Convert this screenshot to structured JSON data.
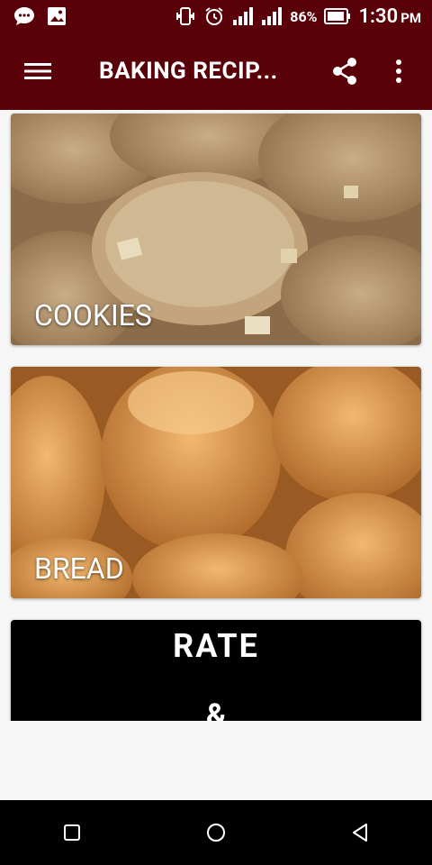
{
  "status_bar": {
    "battery": "86%",
    "time": "1:30",
    "ampm": "PM",
    "icons": [
      "chat-icon",
      "image-icon",
      "vibrate-icon",
      "alarm-icon",
      "signal-icon",
      "signal-icon",
      "battery-icon"
    ]
  },
  "app_bar": {
    "title": "BAKING RECIP...",
    "color": "#5a0009",
    "icons": [
      "menu-icon",
      "share-icon",
      "more-vert-icon"
    ]
  },
  "cards": [
    {
      "label": "COOKIES"
    },
    {
      "label": "BREAD"
    },
    {
      "title": "RATE",
      "subtitle": "&"
    }
  ],
  "nav_bar": {
    "icons": [
      "recents-icon",
      "home-icon",
      "back-icon"
    ]
  }
}
